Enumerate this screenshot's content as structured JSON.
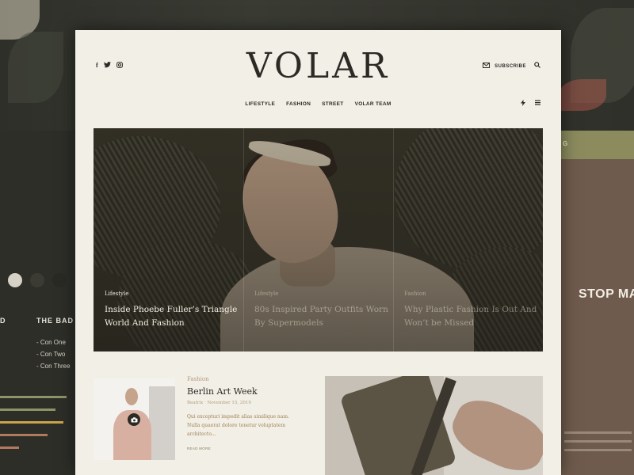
{
  "background": {
    "left_panel": {
      "header_partial": "D",
      "heading": "THE BAD",
      "items": [
        "- Con One",
        "- Con Two",
        "- Con Three"
      ]
    },
    "right_panel": {
      "header_partial": "G",
      "headline_partial": "STOP MAK"
    }
  },
  "site": {
    "logo": "VOLAR",
    "social": {
      "facebook": "f",
      "twitter": "t",
      "instagram": "◎"
    },
    "subscribe_label": "SUBSCRIBE",
    "nav": [
      "LIFESTYLE",
      "FASHION",
      "STREET",
      "VOLAR TEAM"
    ]
  },
  "hero": {
    "items": [
      {
        "category": "Lifestyle",
        "title": "Inside Phoebe Fuller’s Triangle World And Fashion"
      },
      {
        "category": "Lifestyle",
        "title": "80s Inspired Party Outfits Worn By Supermodels"
      },
      {
        "category": "Fashion",
        "title": "Why Plastic Fashion Is Out And Won’t be Missed"
      }
    ]
  },
  "article": {
    "category": "Fashion",
    "title": "Berlin Art Week",
    "author": "Beatrix",
    "date": "November 15, 2019",
    "excerpt": "Qui excepturi impedit alias similique nam. Nulla quaerat dolore tenetur voluptatem architecto...",
    "read_more": "READ MORE"
  },
  "colors": {
    "card_bg": "#f1efe6",
    "text": "#2b2a25",
    "accent": "#b49b7c"
  }
}
